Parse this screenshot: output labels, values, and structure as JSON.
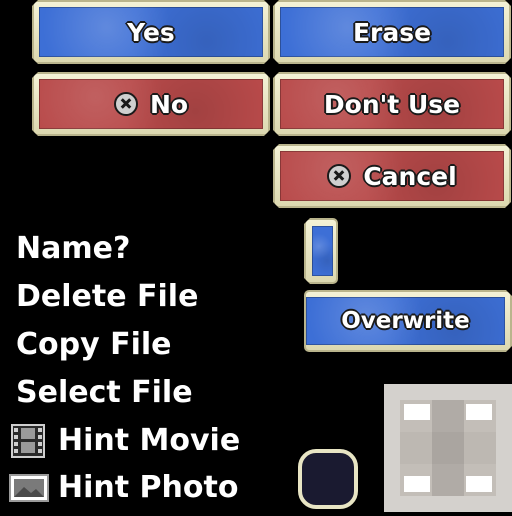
{
  "buttons": {
    "yes": "Yes",
    "erase": "Erase",
    "no": "No",
    "dont_use": "Don't Use",
    "cancel": "Cancel",
    "overwrite": "Overwrite"
  },
  "menu": {
    "name": "Name?",
    "delete_file": "Delete File",
    "copy_file": "Copy File",
    "select_file": "Select File",
    "hint_movie": "Hint Movie",
    "hint_photo": "Hint Photo"
  },
  "icons": {
    "circle_button": "circle-x-button-icon",
    "film": "film-strip-icon",
    "photo": "photo-icon"
  },
  "colors": {
    "blue_button": "#3d6fd6",
    "red_button": "#b84a4a",
    "frame": "#e8e5c4"
  }
}
